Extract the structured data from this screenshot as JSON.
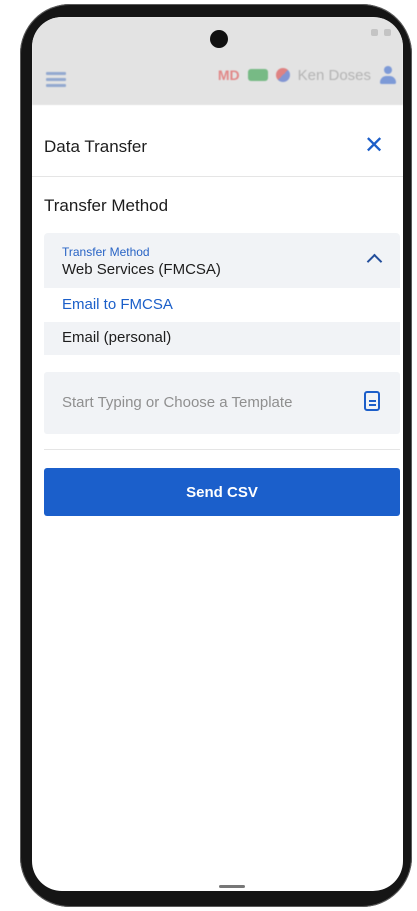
{
  "header": {
    "badge_md": "MD",
    "user_name": "Ken Doses"
  },
  "panel": {
    "title": "Data Transfer",
    "close_icon_glyph": "✕"
  },
  "transfer": {
    "section_title": "Transfer Method",
    "dropdown_label": "Transfer Method",
    "current_value": "Web Services (FMCSA)",
    "options": [
      {
        "label": "Email to FMCSA",
        "selected": true
      },
      {
        "label": "Email (personal)",
        "selected": false
      }
    ]
  },
  "template": {
    "placeholder": "Start Typing or Choose a Template"
  },
  "actions": {
    "send_label": "Send CSV"
  },
  "colors": {
    "accent": "#1b5fcb",
    "header_bg": "#e3e3e3",
    "field_bg": "#f1f3f6"
  },
  "icons": [
    "hamburger-icon",
    "flag-icon",
    "user-icon",
    "close-icon",
    "chevron-up-icon",
    "document-icon",
    "camera-icon"
  ]
}
